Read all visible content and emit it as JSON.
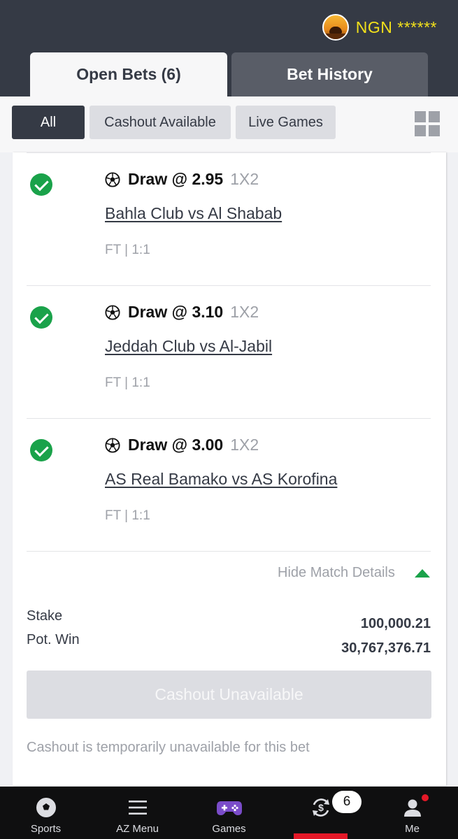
{
  "header": {
    "balance_label": "NGN ******"
  },
  "tabs": {
    "open_bets": "Open Bets (6)",
    "bet_history": "Bet History"
  },
  "filters": {
    "all": "All",
    "cashout_available": "Cashout Available",
    "live_games": "Live Games"
  },
  "bets": [
    {
      "selection": "Draw @ 2.95",
      "market": "1X2",
      "match": "Bahla Club vs Al Shabab",
      "result": "FT | 1:1",
      "status": "won"
    },
    {
      "selection": "Draw @ 3.10",
      "market": "1X2",
      "match": "Jeddah Club vs Al-Jabil",
      "result": "FT | 1:1",
      "status": "won"
    },
    {
      "selection": "Draw @ 3.00",
      "market": "1X2",
      "match": "AS Real Bamako vs AS Korofina",
      "result": "FT | 1:1",
      "status": "won"
    }
  ],
  "details": {
    "hide_label": "Hide Match Details",
    "stake_label": "Stake",
    "stake_value": "100,000.21",
    "potwin_label": "Pot. Win",
    "potwin_value": "30,767,376.71",
    "cashout_button": "Cashout Unavailable",
    "cashout_note": "Cashout is temporarily unavailable for this bet"
  },
  "nav": {
    "sports": "Sports",
    "az_menu": "AZ Menu",
    "games": "Games",
    "open_bets_count": "6",
    "me": "Me"
  },
  "colors": {
    "header_bg": "#353a45",
    "accent_green": "#1aa24a",
    "balance_yellow": "#f2e01b",
    "active_red": "#e41827"
  }
}
